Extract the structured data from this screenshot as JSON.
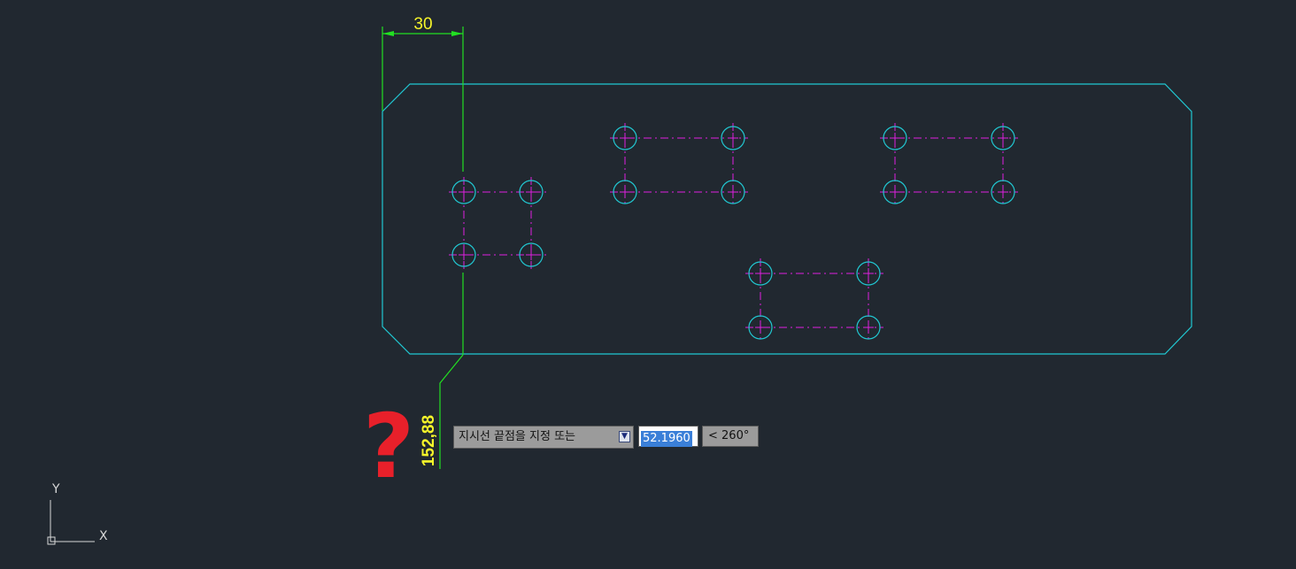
{
  "dimension": {
    "horizontal_value": "30",
    "vertical_value": "152,88"
  },
  "dynamic_input": {
    "prompt": "지시선 끝점을 지정 또는",
    "distance": "52.1960",
    "angle": "< 260°"
  },
  "annotation": {
    "question_mark": "?"
  },
  "ucs": {
    "x_label": "X",
    "y_label": "Y"
  },
  "colors": {
    "background": "#212830",
    "outline": "#21c8d2",
    "centerline": "#e020e0",
    "dimension": "#22e022",
    "dimension_text": "#f6f52a",
    "question": "#e8202a",
    "ucs": "#d8d8d8"
  }
}
